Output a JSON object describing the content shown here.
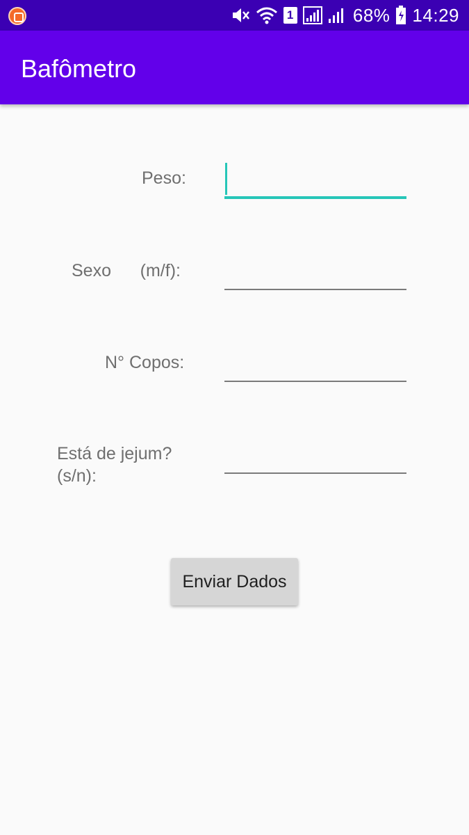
{
  "status_bar": {
    "battery_percent": "68%",
    "time": "14:29",
    "sim_slot": "1",
    "icons": [
      "app-notification-icon",
      "mute-icon",
      "wifi-icon",
      "sim-icon",
      "signal-icon",
      "signal-2-icon",
      "battery-icon"
    ]
  },
  "app_bar": {
    "title": "Bafômetro",
    "color": "#6200ea"
  },
  "form": {
    "peso_label": "Peso:",
    "sexo_label": "Sexo      (m/f):",
    "copos_label": "N° Copos:",
    "jejum_label_line1": "Está de jejum?",
    "jejum_label_line2": "(s/n):",
    "peso_value": "",
    "sexo_value": "",
    "copos_value": "",
    "jejum_value": ""
  },
  "actions": {
    "send_label": "Enviar Dados"
  },
  "colors": {
    "status_bar": "#3b00b3",
    "accent": "#26c6b8",
    "background": "#fafafa"
  }
}
